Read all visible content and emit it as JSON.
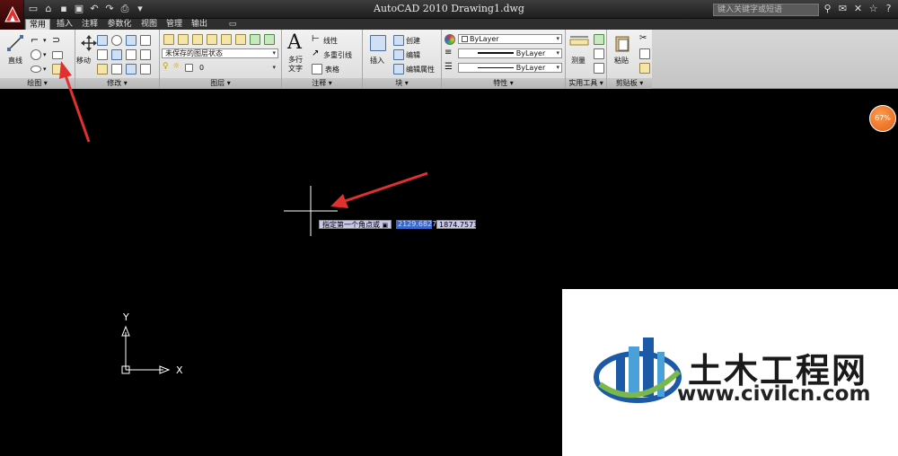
{
  "window": {
    "title": "AutoCAD 2010   Drawing1.dwg",
    "search_placeholder": "键入关键字或短语"
  },
  "tabs": [
    "常用",
    "插入",
    "注释",
    "参数化",
    "视图",
    "管理",
    "输出"
  ],
  "ribbon": {
    "draw": {
      "title": "绘图",
      "line": "直线"
    },
    "modify": {
      "title": "修改",
      "move": "移动"
    },
    "layers": {
      "title": "图层",
      "layer_state": "未保存的图层状态",
      "current_layer": "0"
    },
    "annotation": {
      "title": "注释",
      "mtext_line1": "多行",
      "mtext_line2": "文字",
      "linear": "线性",
      "multileader": "多重引线",
      "table": "表格"
    },
    "block": {
      "title": "块",
      "insert": "插入",
      "create": "创建",
      "edit": "编辑",
      "edit_attr": "编辑属性"
    },
    "properties": {
      "title": "特性",
      "color": "ByLayer",
      "linetype": "ByLayer",
      "lineweight": "ByLayer"
    },
    "utilities": {
      "title": "实用工具",
      "measure": "测量"
    },
    "clipboard": {
      "title": "剪贴板",
      "paste": "粘贴"
    }
  },
  "canvas": {
    "cmd_prompt": "指定第一个角点或",
    "coord_x": "2129.6827",
    "coord_y": "1874.7573",
    "zoom": "67%",
    "axis_x": "X",
    "axis_y": "Y"
  },
  "watermark": {
    "name": "土木工程网",
    "url": "www.civilcn.com"
  },
  "colors": {
    "accent_arrow": "#e03030",
    "canvas_bg": "#000000",
    "ribbon_bg": "#e6e6e6"
  }
}
